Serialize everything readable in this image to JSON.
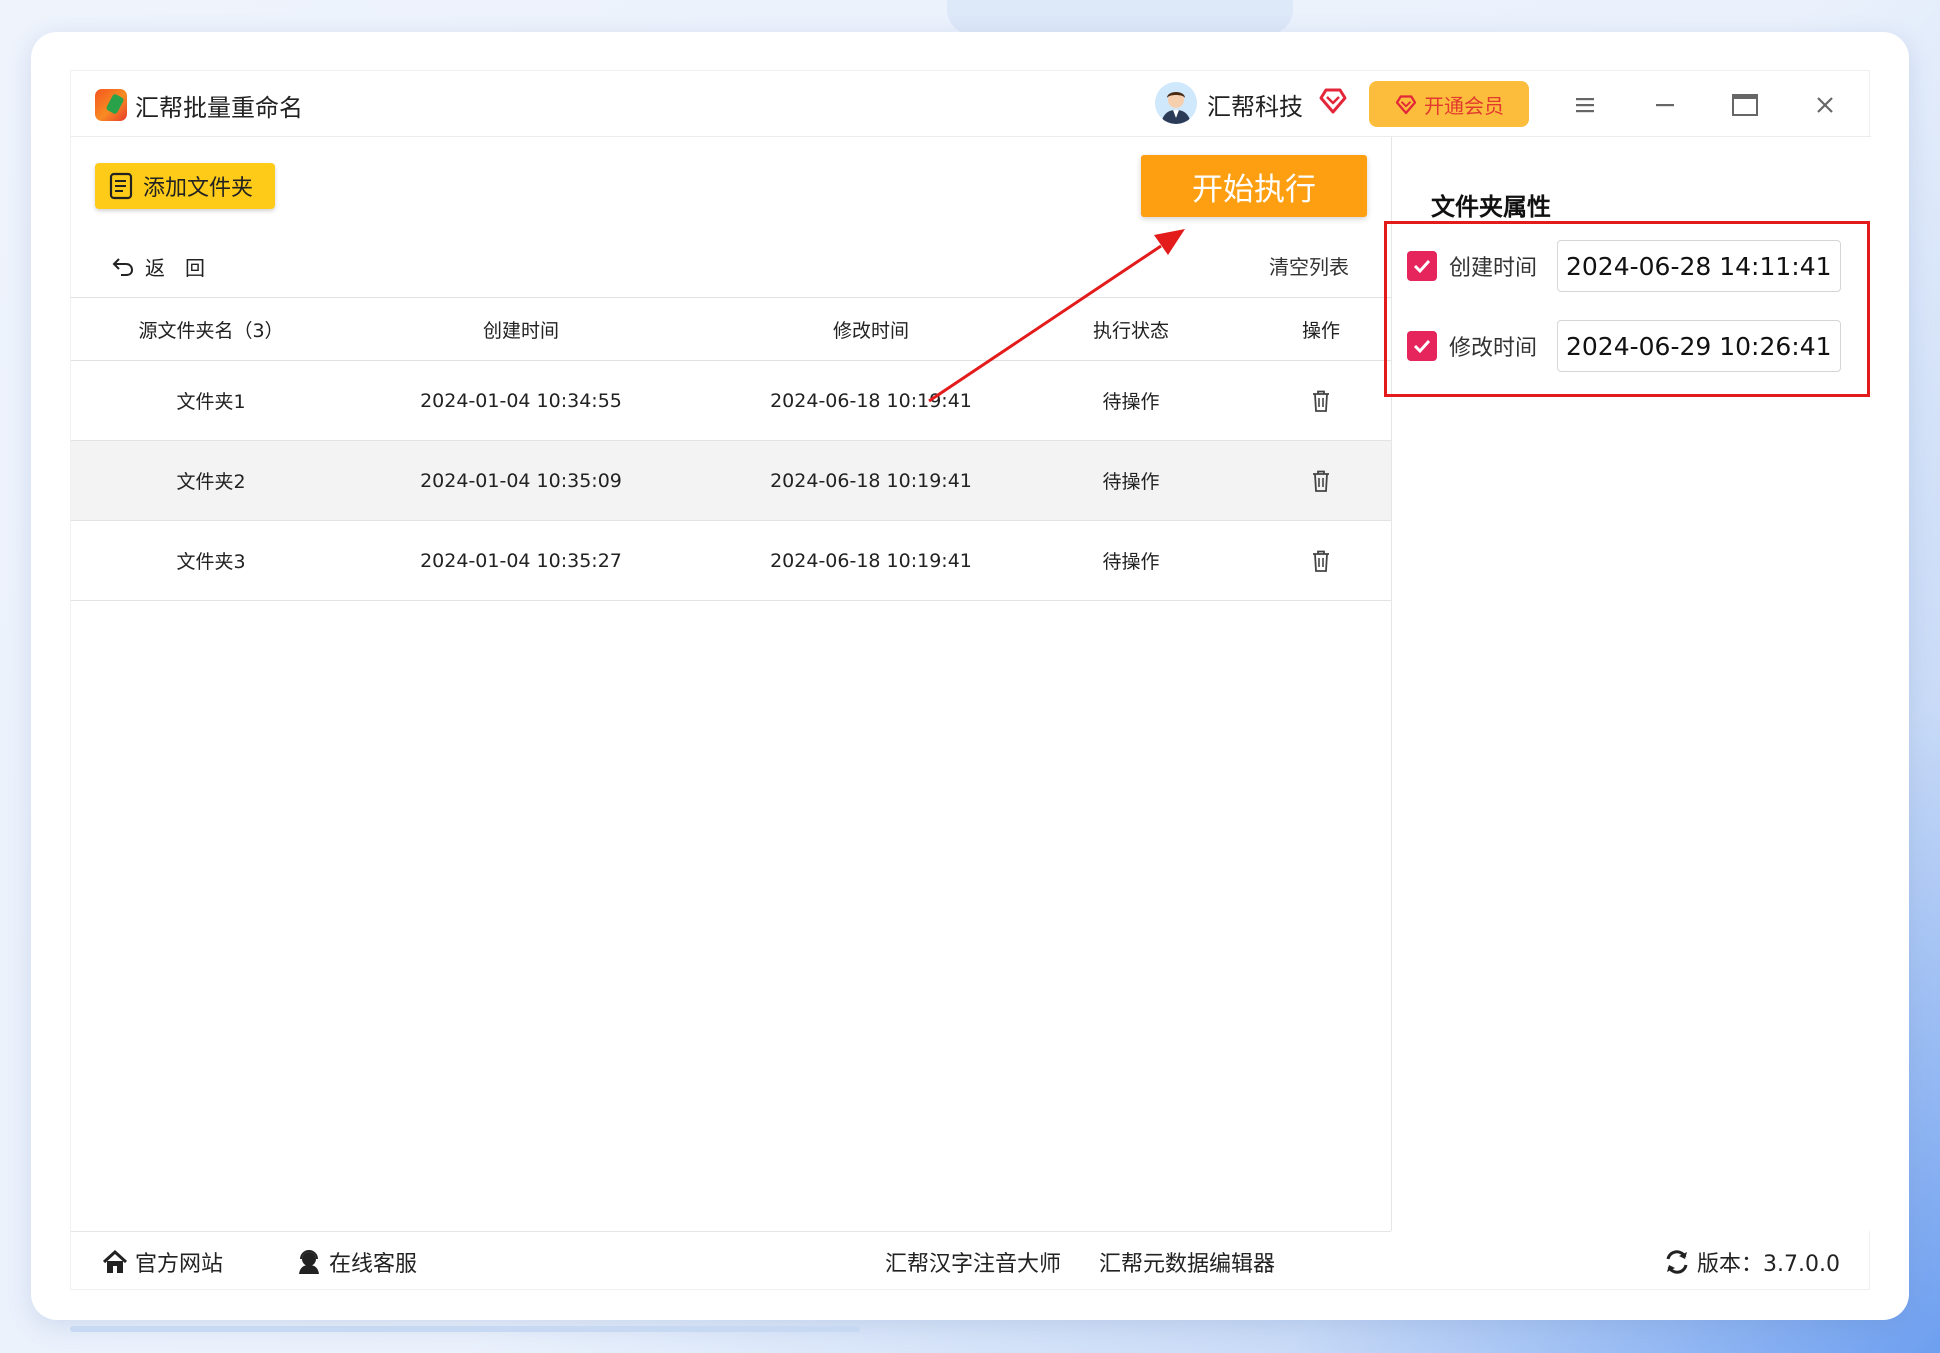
{
  "titlebar": {
    "app_title": "汇帮批量重命名",
    "user_name": "汇帮科技",
    "vip_label": "开通会员",
    "accent_color": "#fd9f11"
  },
  "toolbar": {
    "add_folder_label": "添加文件夹",
    "start_label": "开始执行",
    "back_label": "返　回",
    "clear_label": "清空列表"
  },
  "table": {
    "headers": {
      "name": "源文件夹名（3）",
      "created": "创建时间",
      "modified": "修改时间",
      "status": "执行状态",
      "action": "操作"
    },
    "rows": [
      {
        "name": "文件夹1",
        "created": "2024-01-04 10:34:55",
        "modified": "2024-06-18 10:19:41",
        "status": "待操作"
      },
      {
        "name": "文件夹2",
        "created": "2024-01-04 10:35:09",
        "modified": "2024-06-18 10:19:41",
        "status": "待操作"
      },
      {
        "name": "文件夹3",
        "created": "2024-01-04 10:35:27",
        "modified": "2024-06-18 10:19:41",
        "status": "待操作"
      }
    ]
  },
  "attributes": {
    "title": "文件夹属性",
    "created_label": "创建时间",
    "created_value": "2024-06-28 14:11:41",
    "created_checked": true,
    "modified_label": "修改时间",
    "modified_value": "2024-06-29 10:26:41",
    "modified_checked": true
  },
  "footer": {
    "official_site": "官方网站",
    "online_service": "在线客服",
    "tool1": "汇帮汉字注音大师",
    "tool2": "汇帮元数据编辑器",
    "version": "版本：3.7.0.0"
  }
}
